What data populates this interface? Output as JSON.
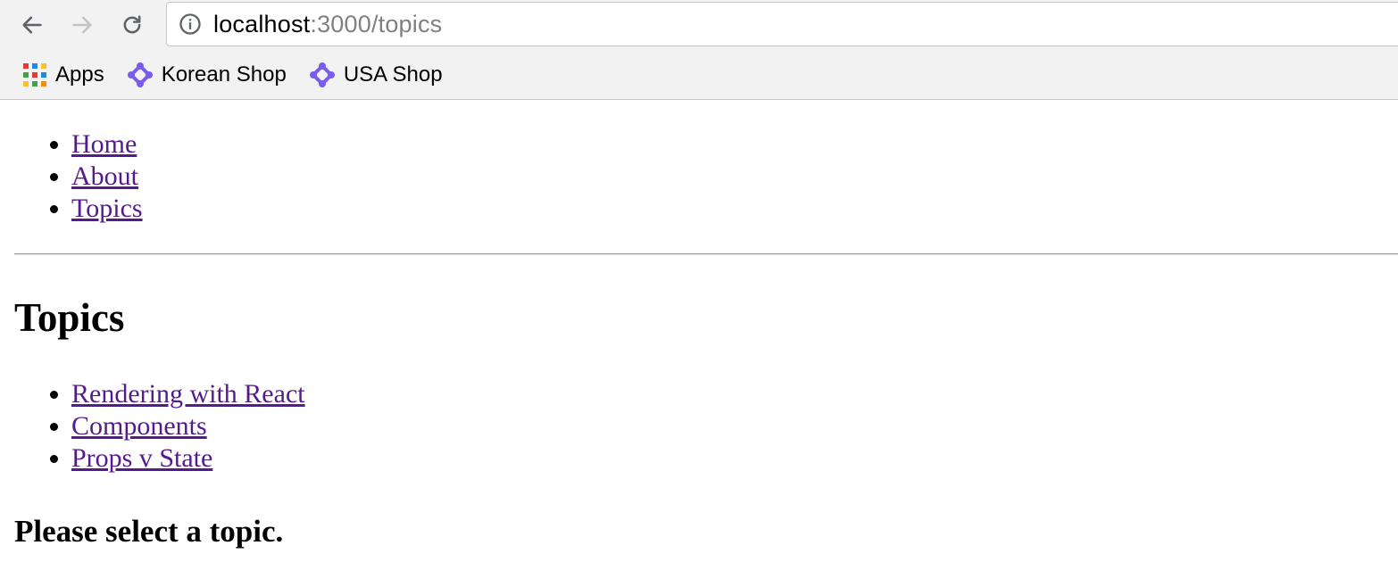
{
  "browser": {
    "url_host": "localhost",
    "url_path": ":3000/topics",
    "bookmarks": [
      {
        "label": "Apps",
        "icon": "apps-grid-icon"
      },
      {
        "label": "Korean Shop",
        "icon": "shop-logo-icon"
      },
      {
        "label": "USA Shop",
        "icon": "shop-logo-icon"
      }
    ],
    "colors": {
      "shop_icon": "#7b5cf0",
      "link": "#551a8b"
    }
  },
  "page": {
    "nav": [
      "Home",
      "About",
      "Topics"
    ],
    "heading": "Topics",
    "topics": [
      "Rendering with React",
      "Components",
      "Props v State"
    ],
    "prompt": "Please select a topic."
  }
}
